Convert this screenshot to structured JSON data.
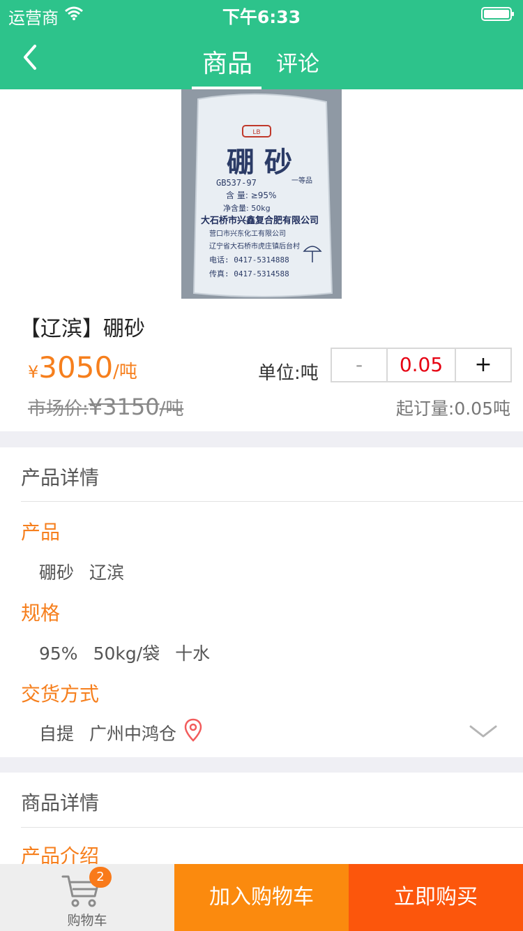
{
  "status": {
    "carrier": "运营商",
    "time": "下午6:33"
  },
  "nav": {
    "tabs": [
      {
        "label": "商品",
        "active": true
      },
      {
        "label": "评论",
        "active": false
      }
    ]
  },
  "product": {
    "name": "【辽滨】硼砂",
    "image": {
      "title_chars": "硼   砂",
      "standard": "GB537-97",
      "grade": "一等品",
      "content": "含  量: ≥95%",
      "net_weight": "净含量:        50kg",
      "maker": "大石桥市兴鑫复合肥有限公司",
      "maker2": "营口市兴东化工有限公司",
      "address": "辽宁省大石桥市虎庄镇后台村",
      "phone": "电话: 0417-5314888",
      "fax": "传真: 0417-5314588"
    },
    "price_symbol": "¥",
    "price": "3050",
    "price_unit": "/吨",
    "unit_label": "单位:吨",
    "quantity": {
      "minus": "-",
      "value": "0.05",
      "plus": "+"
    },
    "market_price_label": "市场价:",
    "market_price_value": "¥3150",
    "market_price_unit": "/吨",
    "min_order": "起订量:0.05吨"
  },
  "detail": {
    "title": "产品详情",
    "product_heading": "产品",
    "product_tags": [
      "硼砂",
      "辽滨"
    ],
    "spec_heading": "规格",
    "spec_tags": [
      "95%",
      "50kg/袋",
      "十水"
    ],
    "delivery_heading": "交货方式",
    "delivery_tags": [
      "自提",
      "广州中鸿仓"
    ]
  },
  "goods_detail": {
    "title": "商品详情",
    "intro_heading": "产品介绍"
  },
  "bottom": {
    "cart_label": "购物车",
    "cart_count": "2",
    "add_to_cart": "加入购物车",
    "buy_now": "立即购买"
  },
  "colors": {
    "header": "#2dc38b",
    "accent_orange": "#f67f1d",
    "add_cart": "#fb8a0e",
    "buy_now": "#fc560c",
    "quantity_red": "#e60012"
  }
}
